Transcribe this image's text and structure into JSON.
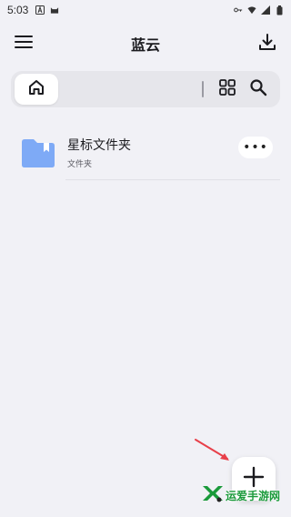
{
  "status_bar": {
    "time": "5:03",
    "icons": [
      "app-a-icon",
      "cat-icon",
      "key-icon",
      "wifi-icon",
      "signal-icon",
      "battery-icon"
    ]
  },
  "app_bar": {
    "title": "蓝云",
    "menu_icon": "menu-icon",
    "download_icon": "download-icon"
  },
  "search_bar": {
    "home_icon": "home-icon",
    "grid_icon": "grid-view-icon",
    "search_icon": "search-icon"
  },
  "file_list": [
    {
      "name": "星标文件夹",
      "type": "文件夹",
      "icon": "folder-icon",
      "more_label": "•••"
    }
  ],
  "fab": {
    "icon": "plus-icon"
  },
  "watermark": {
    "text": "运爱手游网"
  },
  "colors": {
    "background": "#f1f1f6",
    "folder": "#7eaaf6",
    "arrow": "#e8404a",
    "watermark": "#1a9a3a"
  }
}
